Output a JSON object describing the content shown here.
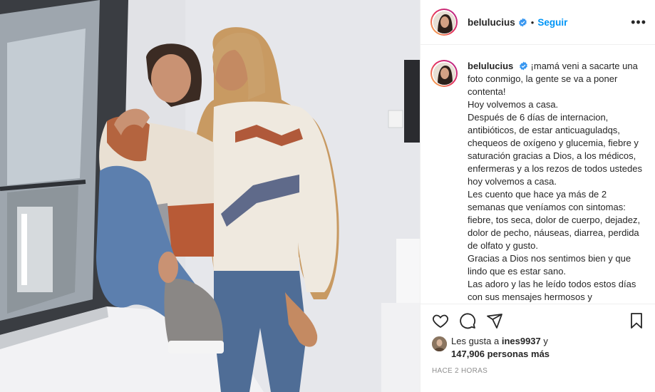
{
  "post": {
    "username": "belulucius",
    "follow_label": "Seguir",
    "dot": "•",
    "more_label": "•••",
    "caption": "¡mamá veni a sacarte una foto conmigo, la gente se va a poner contenta!\nHoy volvemos a casa.\nDespués de 6 días de internacion, antibióticos, de estar anticuaguladqs, chequeos de oxígeno y glucemia, fiebre y saturación gracias a Dios, a los médicos, enfermeras y a los rezos de todos ustedes hoy volvemos a casa.\nLes cuento que hace ya más de 2 semanas que veníamos con sintomas: fiebre, tos seca, dolor de cuerpo, dejadez, dolor de pecho, náuseas, diarrea, perdida de olfato y gusto.\nGracias a Dios nos sentimos bien y que lindo que es estar sano.\nLas adoro y las he leído todos estos días con sus mensajes hermosos y",
    "likes": {
      "prefix": "Les gusta a ",
      "liker": "ines9937",
      "joiner": " y",
      "count": "147,906 personas más"
    },
    "time": "HACE 2 HORAS"
  },
  "icons": {
    "verified": "verified-badge-icon",
    "like": "heart-icon",
    "comment": "comment-icon",
    "share": "paper-plane-icon",
    "save": "bookmark-icon"
  },
  "colors": {
    "accent": "#0095f6",
    "verified": "#3897f0",
    "text": "#262626",
    "muted": "#8e8e8e"
  }
}
